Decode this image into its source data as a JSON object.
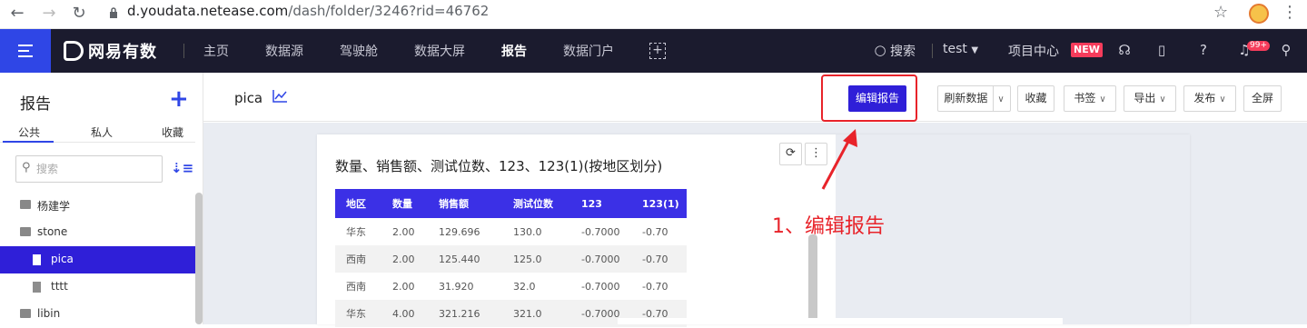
{
  "browser": {
    "url_host": "d.youdata.netease.com",
    "url_path": "/dash/folder/3246?rid=46762"
  },
  "topbar": {
    "logo": "网易有数",
    "nav": [
      "主页",
      "数据源",
      "驾驶舱",
      "数据大屏",
      "报告",
      "数据门户"
    ],
    "active_nav": "报告",
    "search": "搜索",
    "user": "test",
    "project_center": "项目中心",
    "new_badge": "NEW",
    "bell_badge": "99+"
  },
  "sidebar": {
    "title": "报告",
    "tabs": [
      "公共",
      "私人",
      "收藏"
    ],
    "search_placeholder": "搜索",
    "tree": [
      {
        "label": "杨建学",
        "type": "folder"
      },
      {
        "label": "stone",
        "type": "folder"
      },
      {
        "label": "pica",
        "type": "file",
        "selected": true
      },
      {
        "label": "tttt",
        "type": "file"
      },
      {
        "label": "libin",
        "type": "folder"
      }
    ]
  },
  "header": {
    "report_title": "pica",
    "buttons": {
      "edit": "编辑报告",
      "refresh": "刷新数据",
      "favorite": "收藏",
      "bookmark": "书签",
      "export": "导出",
      "publish": "发布",
      "fullscreen": "全屏"
    }
  },
  "card": {
    "title": "数量、销售额、测试位数、123、123(1)(按地区划分)",
    "table": {
      "headers": [
        "地区",
        "数量",
        "销售额",
        "测试位数",
        "123",
        "123(1)"
      ],
      "rows": [
        [
          "华东",
          "2.00",
          "129.696",
          "130.0",
          "-0.7000",
          "-0.70"
        ],
        [
          "西南",
          "2.00",
          "125.440",
          "125.0",
          "-0.7000",
          "-0.70"
        ],
        [
          "西南",
          "2.00",
          "31.920",
          "32.0",
          "-0.7000",
          "-0.70"
        ],
        [
          "华东",
          "4.00",
          "321.216",
          "321.0",
          "-0.7000",
          "-0.70"
        ]
      ]
    }
  },
  "annotation": "1、编辑报告",
  "colors": {
    "primary": "#2f1fd8",
    "topbar_bg": "#1b1b2e",
    "annotation_red": "#e8232a"
  }
}
